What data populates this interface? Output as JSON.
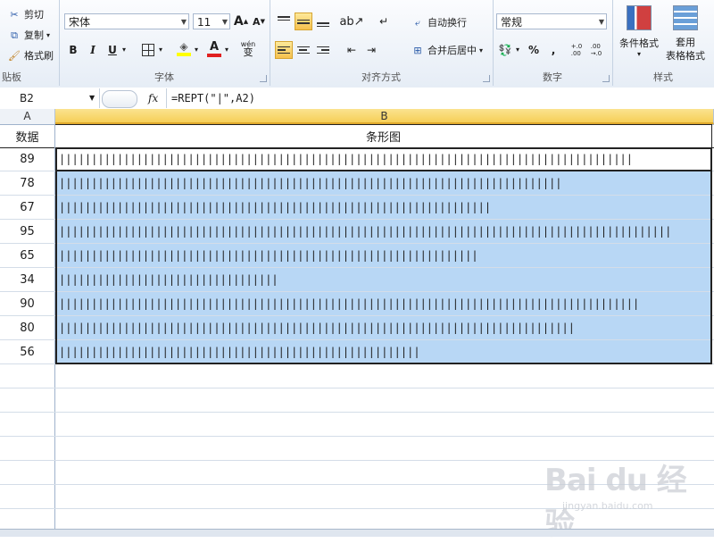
{
  "ribbon": {
    "clipboard": {
      "cut": "剪切",
      "copy": "复制",
      "format_painter": "格式刷",
      "label": "贴板"
    },
    "font": {
      "name": "宋体",
      "size": "11",
      "label": "字体",
      "grow": "A",
      "shrink": "A",
      "bold": "B",
      "italic": "I",
      "underline": "U",
      "wen": "wén",
      "wen_char": "变"
    },
    "alignment": {
      "wrap": "自动换行",
      "merge": "合并后居中",
      "label": "对齐方式"
    },
    "number": {
      "format": "常规",
      "percent": "%",
      "comma": ",",
      "inc": "+.0\n.00",
      "dec": ".00\n→.0",
      "label": "数字"
    },
    "styles": {
      "conditional": "条件格式",
      "table": "套用\n表格格式",
      "label": "样式"
    }
  },
  "formula_bar": {
    "name_box": "B2",
    "fx": "fx",
    "formula": "=REPT(\"|\",A2)"
  },
  "columns": [
    "A",
    "B"
  ],
  "header": {
    "a": "数据",
    "b": "条形图"
  },
  "rows": [
    89,
    78,
    67,
    95,
    65,
    34,
    90,
    80,
    56
  ],
  "watermark": {
    "logo": "Bai du 经验",
    "url": "jingyan.baidu.com"
  },
  "colors": {
    "selection": "#b8d7f5",
    "active_button": "#f6c04d",
    "header_highlight": "#f9d769"
  }
}
